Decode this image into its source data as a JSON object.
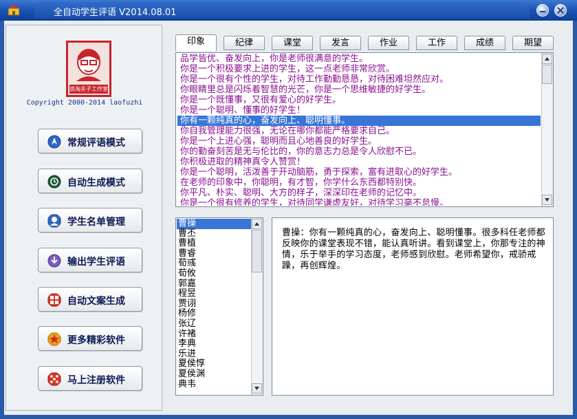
{
  "window": {
    "title": "全自动学生评语 V2014.08.01"
  },
  "logo": {
    "caption": "浪淘夫子工作室",
    "copyright": "Copyright 2000-2014 laofuzhi"
  },
  "nav": [
    {
      "label": "常规评语模式",
      "icon": "compass-icon",
      "color": "#2d66c4"
    },
    {
      "label": "自动生成模式",
      "icon": "history-icon",
      "color": "#1a6a3a"
    },
    {
      "label": "学生名单管理",
      "icon": "student-icon",
      "color": "#2d66c4"
    },
    {
      "label": "输出学生评语",
      "icon": "download-icon",
      "color": "#7a5cc0"
    },
    {
      "label": "自动文案生成",
      "icon": "document-grid-icon",
      "color": "#d23a2a"
    },
    {
      "label": "更多精彩软件",
      "icon": "star-icon",
      "color": "#e7a020"
    },
    {
      "label": "马上注册软件",
      "icon": "dice-icon",
      "color": "#d23a2a"
    }
  ],
  "tabs": [
    "印象",
    "纪律",
    "课堂",
    "发言",
    "作业",
    "工作",
    "成绩",
    "期望"
  ],
  "active_tab": "印象",
  "comments": [
    "品学皆优、奋发向上，你是老师很满意的学生。",
    "你是一个积极要求上进的学生，这一点老师非常欣赏。",
    "你是一个很有个性的学生，对待工作勤勤恳恳，对待困难坦然应对。",
    "你眼睛里总是闪烁着智慧的光芒，你是一个思维敏捷的好学生。",
    "你是一个既懂事，又很有爱心的好学生。",
    "你是一个聪明、懂事的好学生！",
    "你有一颗纯真的心，奋发向上、聪明懂事。",
    "你自我管理能力很强，无论在哪你都能严格要求自己。",
    "你是一个上进心强，聪明而且心地善良的好学生。",
    "你的勤奋刻苦是无与伦比的，你的意志力总是令人欣慰不已。",
    "你积极进取的精神真令人赞赏！",
    "你是一个聪明，活泼善于开动脑筋，勇于探索，富有进取心的好学生。",
    "在老师的印象中，你聪明，有才智，你学什么东西都特别快。",
    "你平凡、朴实、聪明、大方的样子，深深印在老师的记忆中。",
    "你是一个很有修养的学生，对待同学谦虚友好，对待学习毫不怠慢。"
  ],
  "selected_comment_index": 6,
  "students": [
    "曹操",
    "曹丕",
    "曹植",
    "曹睿",
    "荀彧",
    "荀攸",
    "郭嘉",
    "程昱",
    "贾诩",
    "杨修",
    "张辽",
    "许褚",
    "李典",
    "乐进",
    "夏侯惇",
    "夏侯渊",
    "典韦"
  ],
  "selected_student_index": 0,
  "preview": {
    "text": "曹操：你有一颗纯真的心，奋发向上、聪明懂事。很多科任老师都反映你的课堂表现不错，能认真听讲。看到课堂上，你那专注的神情，乐于举手的学习态度，老师感到欣慰。老师希望你，戒骄戒躁，再创辉煌。"
  },
  "colors": {
    "accent": "#3875d7",
    "comment_text": "#8a1090",
    "title_bar": "#1c56b8"
  }
}
